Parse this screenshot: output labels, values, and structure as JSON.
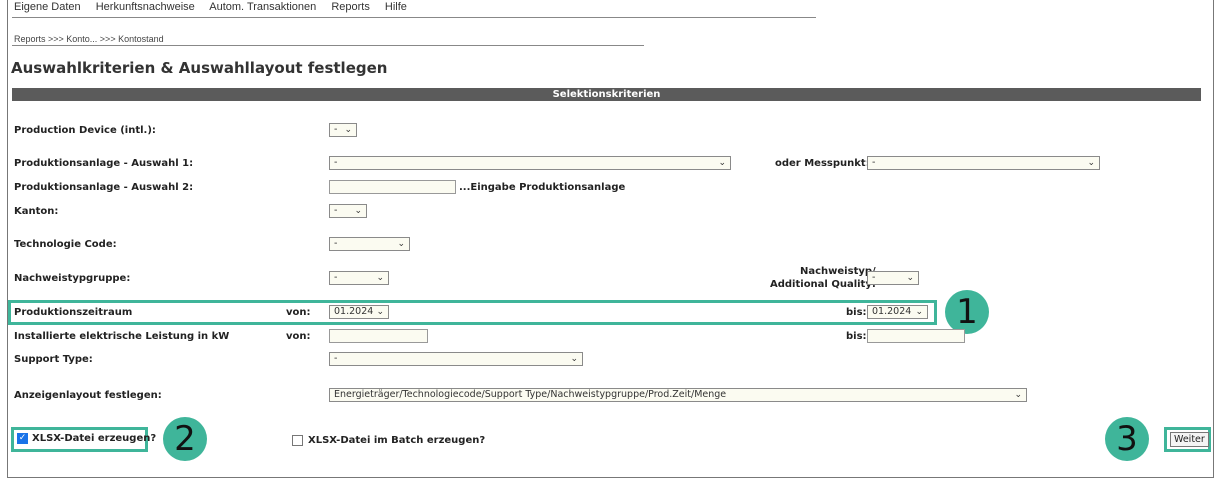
{
  "menu": [
    "Eigene Daten",
    "Herkunftsnachweise",
    "Autom. Transaktionen",
    "Reports",
    "Hilfe"
  ],
  "breadcrumb": "Reports >>> Konto... >>> Kontostand",
  "page_title": "Auswahlkriterien & Auswahllayout festlegen",
  "section_title": "Selektionskriterien",
  "fields": {
    "production_device": {
      "label": "Production Device (intl.):",
      "value": "-"
    },
    "auswahl1": {
      "label": "Produktionsanlage - Auswahl 1:",
      "value": "-"
    },
    "messpunkt": {
      "label": "oder  Messpunkt:",
      "value": "-"
    },
    "auswahl2": {
      "label": "Produktionsanlage - Auswahl 2:",
      "value": "",
      "hint": "...Eingabe Produktionsanlage"
    },
    "kanton": {
      "label": "Kanton:",
      "value": "-"
    },
    "technologie": {
      "label": "Technologie Code:",
      "value": "-"
    },
    "nachweistypgruppe": {
      "label": "Nachweistypgruppe:",
      "value": "-"
    },
    "nachweistyp": {
      "label_line1": "Nachweistyp/",
      "label_line2": "Additional Quality:",
      "value": "-"
    },
    "zeitraum": {
      "label": "Produktionszeitraum",
      "von_label": "von:",
      "von_value": "01.2024",
      "bis_label": "bis:",
      "bis_value": "01.2024"
    },
    "leistung": {
      "label": "Installierte elektrische Leistung in kW",
      "von_label": "von:",
      "bis_label": "bis:"
    },
    "support_type": {
      "label": "Support Type:",
      "value": "-"
    },
    "layout": {
      "label": "Anzeigenlayout festlegen:",
      "value": "Energieträger/Technologiecode/Support Type/Nachweistypgruppe/Prod.Zeit/Menge"
    }
  },
  "xlsx": {
    "label": "XLSX-Datei erzeugen?",
    "checked": true
  },
  "xlsx_batch": {
    "label": "XLSX-Datei im Batch erzeugen?",
    "checked": false
  },
  "weiter_button": "Weiter",
  "markers": [
    "1",
    "2",
    "3"
  ],
  "colors": {
    "highlight": "#3fb59a",
    "section_bar": "#5b5b5b",
    "field_bg": "#fbfbf1"
  }
}
